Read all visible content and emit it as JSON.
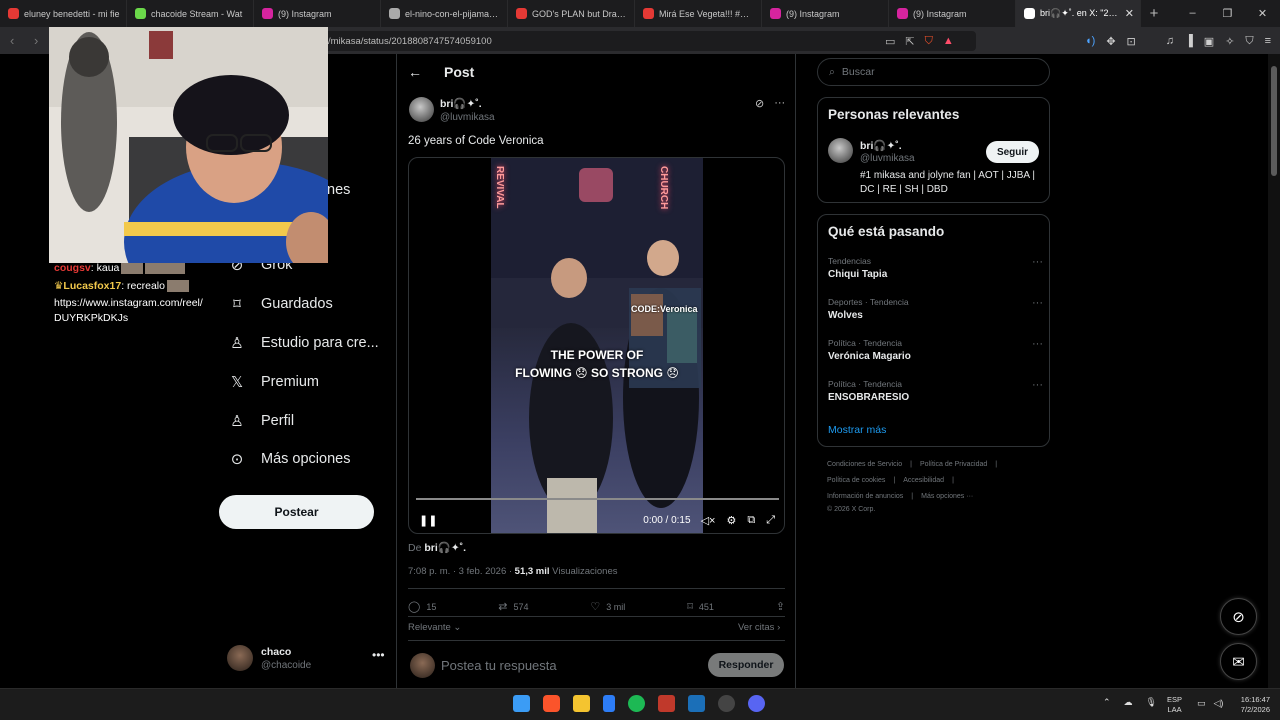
{
  "browser": {
    "tabs": [
      {
        "label": "eluney benedetti - mi fie",
        "icon_color": "#e53935"
      },
      {
        "label": "chacoide Stream - Wat",
        "icon_color": "#6bd84a"
      },
      {
        "label": "(9) Instagram",
        "icon_color": "#d6249f"
      },
      {
        "label": "el-nino-con-el-pijama-de-",
        "icon_color": "#aaaaaa"
      },
      {
        "label": "GOD's PLAN but Drake st",
        "icon_color": "#e53935"
      },
      {
        "label": "Mirá Ese Vegeta!!! #Drago",
        "icon_color": "#e53935"
      },
      {
        "label": "(9) Instagram",
        "icon_color": "#d6249f"
      },
      {
        "label": "(9) Instagram",
        "icon_color": "#d6249f"
      },
      {
        "label": "bri🎧✦˚. en X: \"26 ye",
        "icon_color": "#ffffff",
        "active": true
      }
    ],
    "new_tab": "+",
    "window_controls": [
      "–",
      "❐",
      "✕"
    ],
    "url": "/mikasa/status/2018808747574059100"
  },
  "chat": {
    "lines": [
      {
        "user": "cougsv",
        "user_color": "#e53935",
        "text": ": kaua"
      },
      {
        "user": "Lucasfox17",
        "user_color": "#f2c94c",
        "text": ": recrealo"
      },
      {
        "user": "",
        "user_color": "#ffffff",
        "text": "https://www.instagram.com/reel/"
      },
      {
        "user": "",
        "user_color": "#ffffff",
        "text": "DUYRKPkDKJs"
      }
    ]
  },
  "leftnav": {
    "partial_label": "nes",
    "items": [
      {
        "label": "Grok",
        "icon": "grok-icon"
      },
      {
        "label": "Guardados",
        "icon": "bookmark-icon"
      },
      {
        "label": "Estudio para cre...",
        "icon": "studio-icon"
      },
      {
        "label": "Premium",
        "icon": "x-logo-icon"
      },
      {
        "label": "Perfil",
        "icon": "person-icon"
      },
      {
        "label": "Más opciones",
        "icon": "more-circle-icon"
      }
    ],
    "post_button": "Postear",
    "user": {
      "name": "chaco",
      "handle": "@chacoide",
      "more": "•••"
    }
  },
  "post": {
    "header_title": "Post",
    "back": "←",
    "author_name": "bri🎧✦˚.",
    "author_handle": "@luvmikasa",
    "text": "26 years of Code Veronica",
    "video": {
      "caption_line1": "THE POWER OF",
      "caption_line2": "FLOWING 😞 SO STRONG 😞",
      "sign_left": "REVIVAL",
      "sign_right": "CHURCH",
      "overlay_title": "CODE:Veronica",
      "time": "0:00 / 0:15",
      "progress": 0.0
    },
    "from_prefix": "De ",
    "from_name": "bri🎧✦˚.",
    "timestamp": "7:08 p. m. · 3 feb. 2026 · ",
    "views_count": "51,3 mil",
    "views_label": " Visualizaciones",
    "actions": [
      {
        "icon": "reply-icon",
        "count": "15"
      },
      {
        "icon": "retweet-icon",
        "count": "574"
      },
      {
        "icon": "like-icon",
        "count": "3 mil"
      },
      {
        "icon": "bookmark-icon",
        "count": "451"
      },
      {
        "icon": "share-icon",
        "count": ""
      }
    ],
    "sort_label": "Relevante",
    "quotes_label": "Ver citas",
    "reply_placeholder": "Postea tu respuesta",
    "reply_button": "Responder"
  },
  "sidebar": {
    "search_placeholder": "Buscar",
    "relevant": {
      "title": "Personas relevantes",
      "name": "bri🎧✦˚.",
      "handle": "@luvmikasa",
      "follow": "Seguir",
      "bio": "#1 mikasa and jolyne fan | AOT | JJBA | DC | RE | SH | DBD"
    },
    "trends": {
      "title": "Qué está pasando",
      "items": [
        {
          "category": "Tendencias",
          "title": "Chiqui Tapia"
        },
        {
          "category": "Deportes · Tendencia",
          "title": "Wolves"
        },
        {
          "category": "Política · Tendencia",
          "title": "Verónica Magario"
        },
        {
          "category": "Política · Tendencia",
          "title": "ENSOBRARESIO"
        }
      ],
      "show_more": "Mostrar más"
    },
    "footer": {
      "row1": [
        "Condiciones de Servicio",
        "Política de Privacidad"
      ],
      "row2": [
        "Política de cookies",
        "Accesibilidad"
      ],
      "row3": [
        "Información de anuncios",
        "Más opciones ···"
      ],
      "copyright": "© 2026 X Corp."
    }
  },
  "taskbar": {
    "lang_top": "ESP",
    "lang_bottom": "LAA",
    "time": "16:16:47",
    "date": "7/2/2026"
  }
}
